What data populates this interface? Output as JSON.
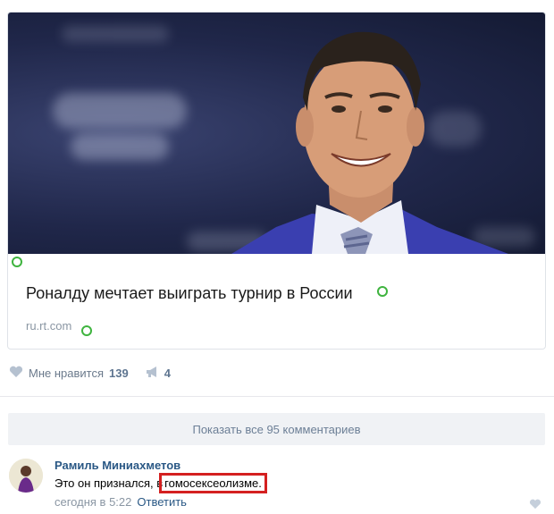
{
  "post": {
    "article_title": "Роналду мечтает выиграть турнир в России",
    "article_domain": "ru.rt.com"
  },
  "actions": {
    "like_label": "Мне нравится",
    "like_count": "139",
    "share_count": "4"
  },
  "comments": {
    "show_all_label": "Показать все 95 комментариев",
    "items": [
      {
        "author": "Рамиль Миниахметов",
        "text_prefix": "Это он признался, в",
        "text_highlight": "гомосексеолизме.",
        "time": "сегодня в 5:22",
        "reply_label": "Ответить"
      }
    ]
  },
  "colors": {
    "link": "#2a5885",
    "highlight_border": "#d42020",
    "photo_bg": "#20274a"
  },
  "icons": {
    "like": "heart-icon",
    "share": "megaphone-icon"
  }
}
